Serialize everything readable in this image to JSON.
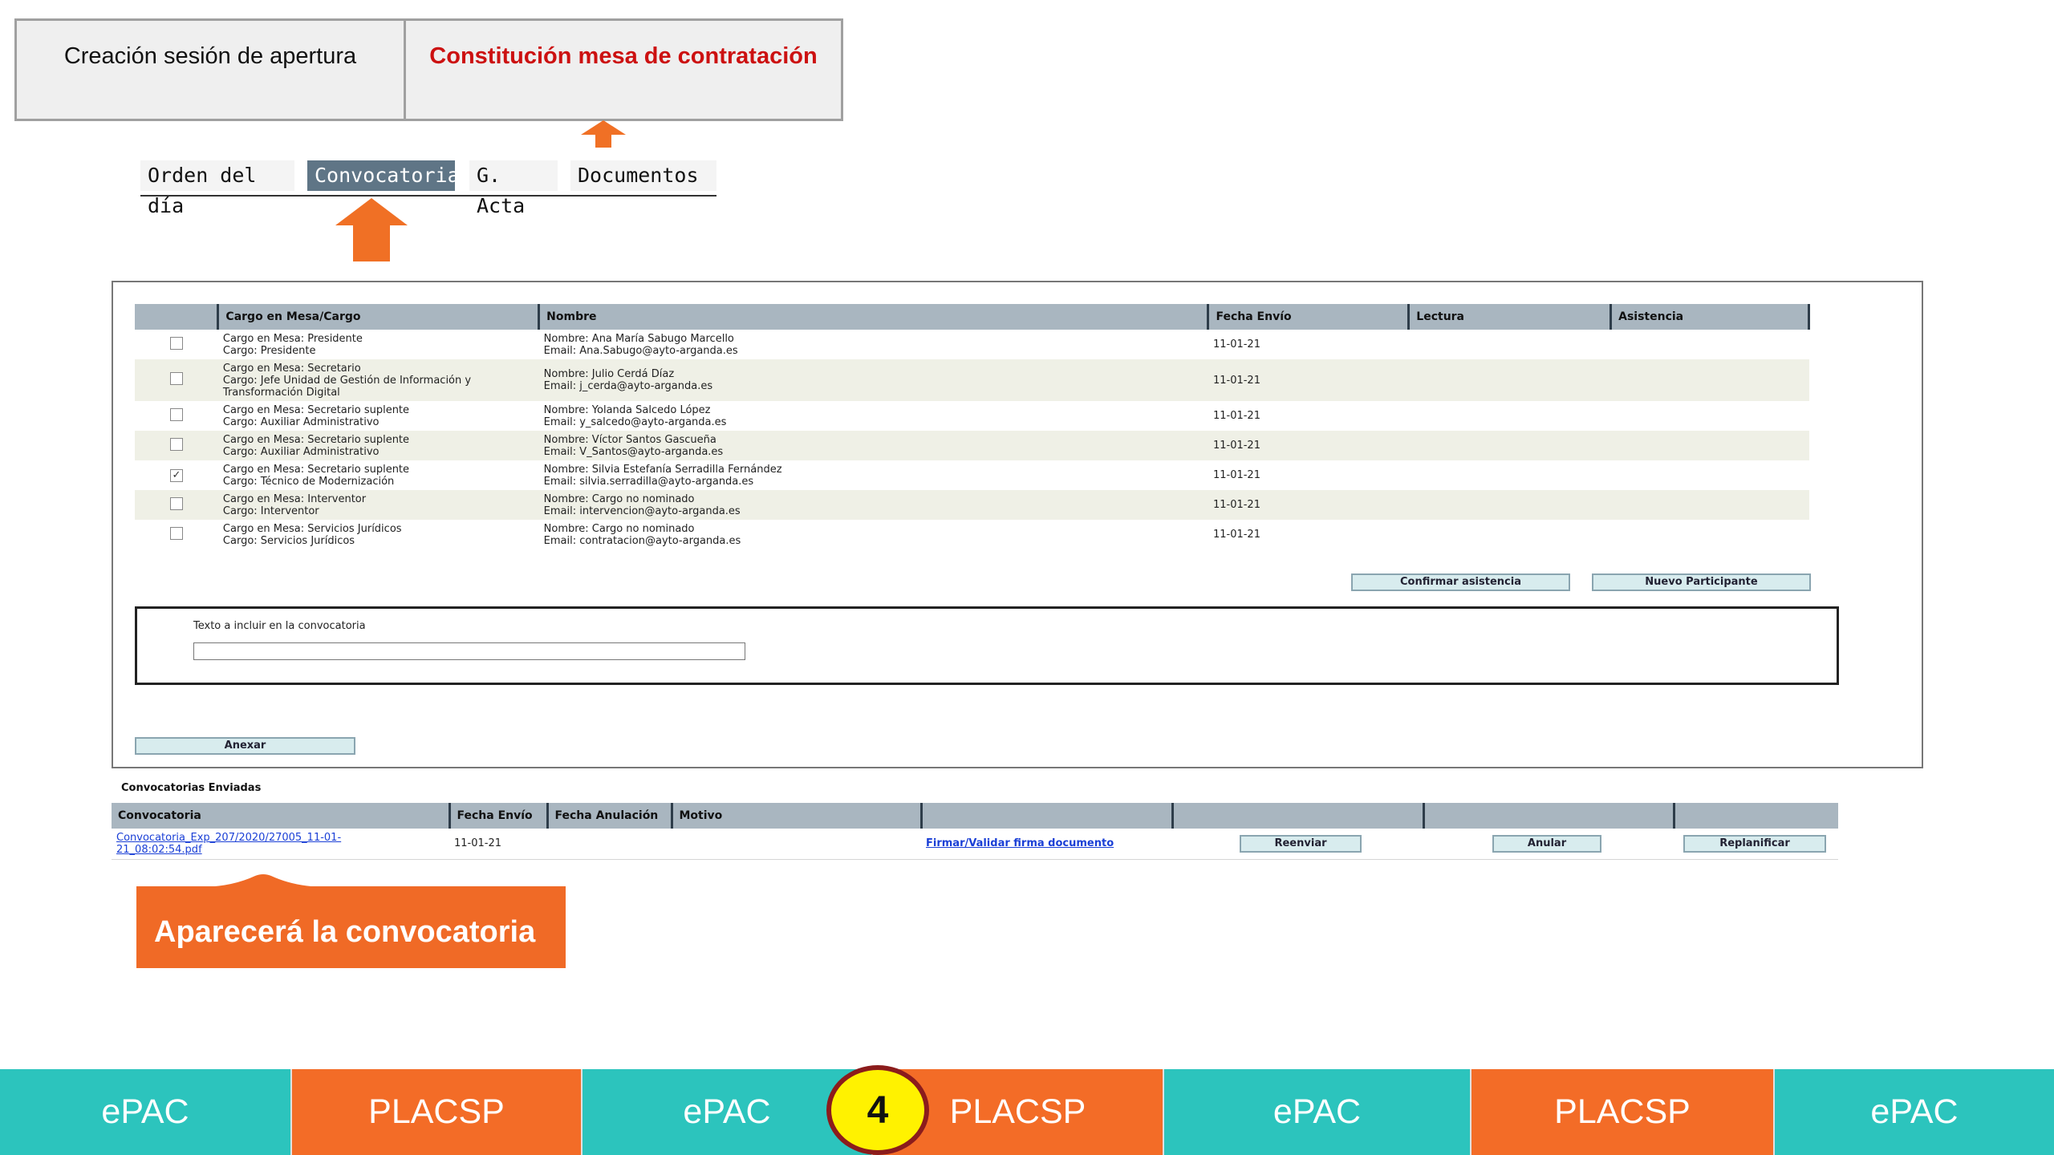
{
  "steps": {
    "step1": "Creación sesión de apertura",
    "step2": "Constitución mesa de contratación"
  },
  "tabs": [
    "Orden del día",
    "Convocatoria",
    "G. Acta",
    "Documentos"
  ],
  "active_tab": "Convocatoria",
  "participants": {
    "headers": [
      "",
      "Cargo en Mesa/Cargo",
      "Nombre",
      "Fecha Envío",
      "Lectura",
      "Asistencia"
    ],
    "rows": [
      {
        "checked": false,
        "cargo": [
          "Cargo en Mesa: Presidente",
          "Cargo: Presidente"
        ],
        "nombre": [
          "Nombre: Ana María Sabugo Marcello",
          "Email: Ana.Sabugo@ayto-arganda.es"
        ],
        "fecha": "11-01-21"
      },
      {
        "checked": false,
        "cargo": [
          "Cargo en Mesa: Secretario",
          "Cargo: Jefe Unidad de Gestión de Información y",
          "Transformación Digital"
        ],
        "nombre": [
          "Nombre: Julio Cerdá Díaz",
          "Email: j_cerda@ayto-arganda.es"
        ],
        "fecha": "11-01-21"
      },
      {
        "checked": false,
        "cargo": [
          "Cargo en Mesa: Secretario suplente",
          "Cargo: Auxiliar Administrativo"
        ],
        "nombre": [
          "Nombre: Yolanda Salcedo López",
          "Email: y_salcedo@ayto-arganda.es"
        ],
        "fecha": "11-01-21"
      },
      {
        "checked": false,
        "cargo": [
          "Cargo en Mesa: Secretario suplente",
          "Cargo: Auxiliar Administrativo"
        ],
        "nombre": [
          "Nombre: Víctor Santos Gascueña",
          "Email: V_Santos@ayto-arganda.es"
        ],
        "fecha": "11-01-21"
      },
      {
        "checked": true,
        "cargo": [
          "Cargo en Mesa: Secretario suplente",
          "Cargo: Técnico de Modernización"
        ],
        "nombre": [
          "Nombre: Silvia Estefanía Serradilla Fernández",
          "Email: silvia.serradilla@ayto-arganda.es"
        ],
        "fecha": "11-01-21"
      },
      {
        "checked": false,
        "cargo": [
          "Cargo en Mesa: Interventor",
          "Cargo: Interventor"
        ],
        "nombre": [
          "Nombre: Cargo no nominado",
          "Email: intervencion@ayto-arganda.es"
        ],
        "fecha": "11-01-21"
      },
      {
        "checked": false,
        "cargo": [
          "Cargo en Mesa: Servicios Jurídicos",
          "Cargo: Servicios Jurídicos"
        ],
        "nombre": [
          "Nombre: Cargo no nominado",
          "Email: contratacion@ayto-arganda.es"
        ],
        "fecha": "11-01-21"
      }
    ]
  },
  "buttons": {
    "confirmar": "Confirmar asistencia",
    "nuevo": "Nuevo Participante",
    "anexar": "Anexar",
    "reenviar": "Reenviar",
    "anular": "Anular",
    "replanificar": "Replanificar"
  },
  "convocatoria_text": {
    "label": "Texto a incluir en la convocatoria",
    "value": ""
  },
  "sent": {
    "title": "Convocatorias Enviadas",
    "headers": [
      "Convocatoria",
      "Fecha Envío",
      "Fecha Anulación",
      "Motivo",
      "",
      "",
      "",
      ""
    ],
    "row": {
      "file_line1": "Convocatoria_Exp_207/2020/27005_11-01-",
      "file_line2": "21_08:02:54.pdf",
      "fecha_envio": "11-01-21",
      "firmar": "Firmar/Validar firma documento"
    }
  },
  "callout": "Aparecerá la convocatoria",
  "bottom_bar": [
    "ePAC",
    "PLACSP",
    "ePAC",
    "PLACSP",
    "ePAC",
    "PLACSP",
    "ePAC"
  ],
  "badge": "4",
  "colors": {
    "orange": "#f06a26",
    "teal": "#2cc4bd",
    "header_gray": "#a9b6c0",
    "active_tab": "#5f7586",
    "step_red": "#cc1111",
    "badge_yellow": "#fff200",
    "badge_border": "#8b1c1c"
  }
}
